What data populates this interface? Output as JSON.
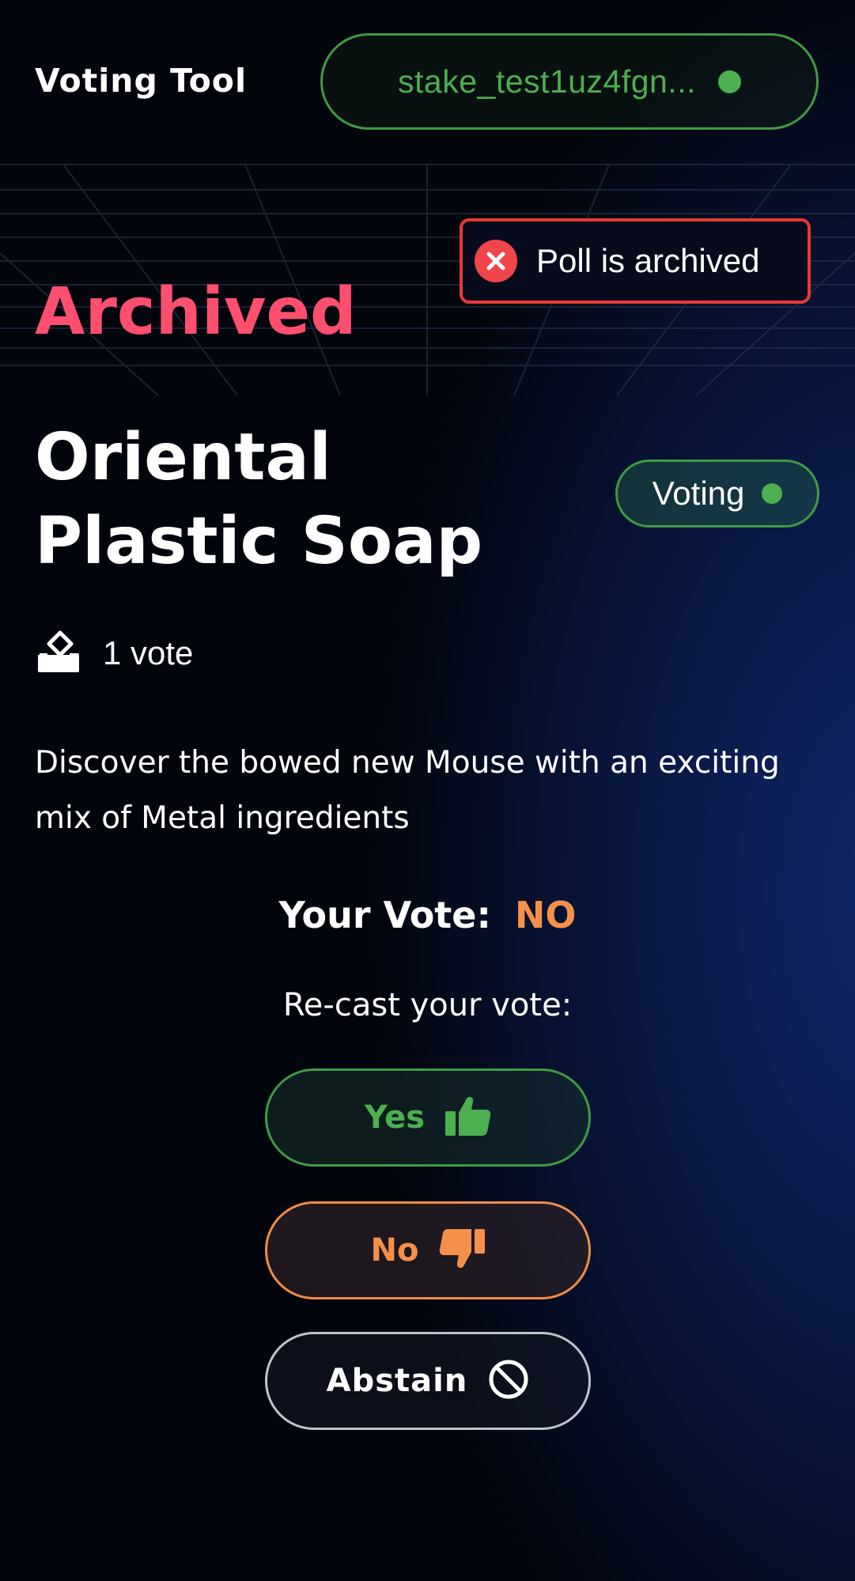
{
  "header": {
    "app_title": "Voting Tool",
    "wallet": {
      "address": "stake_test1uz4fgn...",
      "status_color": "#4caf50"
    }
  },
  "toast": {
    "message": "Poll is archived",
    "icon": "close-circle-icon",
    "color": "#e53935"
  },
  "poll": {
    "status": "Archived",
    "title": "Oriental Plastic Soap",
    "badge": "Voting",
    "vote_count_label": "1 vote",
    "vote_icon": "ballot-icon",
    "description": "Discover the bowed new Mouse with an exciting mix of Metal ingredients"
  },
  "your_vote": {
    "label": "Your Vote:",
    "value": "NO"
  },
  "recast": {
    "prompt": "Re-cast your vote:",
    "buttons": {
      "yes": {
        "label": "Yes",
        "icon": "thumbs-up-icon",
        "color": "#4caf50"
      },
      "no": {
        "label": "No",
        "icon": "thumbs-down-icon",
        "color": "#f5904a"
      },
      "abstain": {
        "label": "Abstain",
        "icon": "prohibited-icon",
        "color": "#ffffff"
      }
    }
  },
  "colors": {
    "accent_green": "#4caf50",
    "archived_pink": "#ff4f6f",
    "vote_orange": "#f5904a",
    "error_red": "#e53935"
  }
}
